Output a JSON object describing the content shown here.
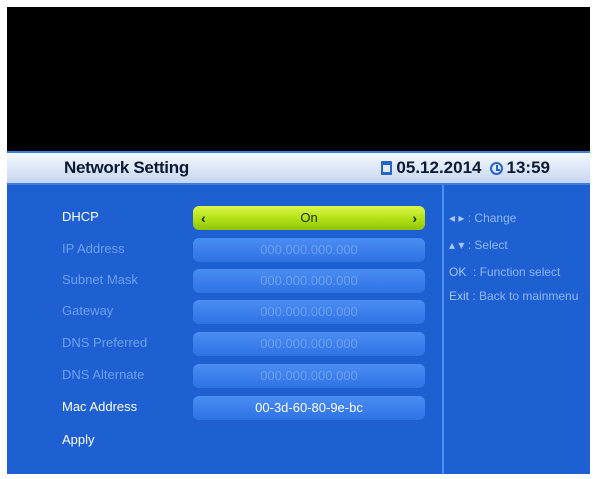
{
  "header": {
    "title": "Network Setting",
    "date": "05.12.2014",
    "time": "13:59",
    "date_icon": "calendar-icon",
    "time_icon": "clock-icon"
  },
  "rows": [
    {
      "label": "DHCP",
      "value": "On",
      "selected": true,
      "enabled": true
    },
    {
      "label": "IP Address",
      "value": "000.000.000.000",
      "selected": false,
      "enabled": false
    },
    {
      "label": "Subnet Mask",
      "value": "000.000.000.000",
      "selected": false,
      "enabled": false
    },
    {
      "label": "Gateway",
      "value": "000.000.000.000",
      "selected": false,
      "enabled": false
    },
    {
      "label": "DNS Preferred",
      "value": "000.000.000.000",
      "selected": false,
      "enabled": false
    },
    {
      "label": "DNS Alternate",
      "value": "000.000.000.000",
      "selected": false,
      "enabled": false
    },
    {
      "label": "Mac Address",
      "value": "00-3d-60-80-9e-bc",
      "selected": false,
      "enabled": true
    },
    {
      "label": "Apply",
      "enabled": true
    }
  ],
  "selector": {
    "left_arrow": "‹",
    "right_arrow": "›"
  },
  "help": [
    {
      "key": "◂ ▸",
      "text": ": Change"
    },
    {
      "key": "▴ ▾",
      "text": ": Select"
    },
    {
      "key": "OK",
      "text": "  : Function select"
    },
    {
      "key": "Exit",
      "text": " : Back to mainmenu"
    }
  ],
  "colors": {
    "panel": "#1e5fd2",
    "selected_field": "#b0e014",
    "disabled_text": "#6ea0ee"
  }
}
